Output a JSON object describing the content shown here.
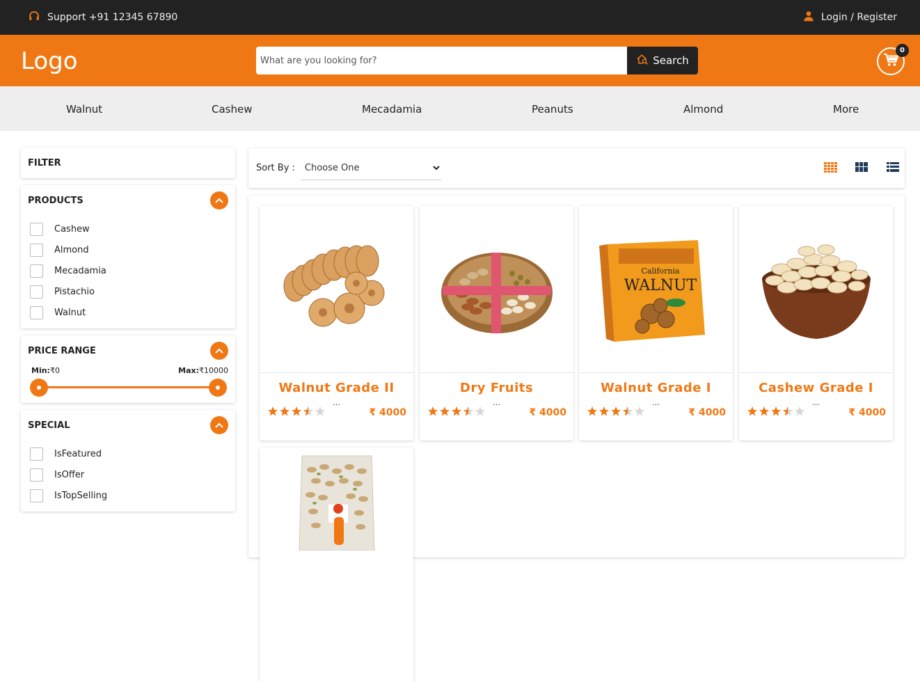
{
  "topbar": {
    "support": "Support +91 12345 67890",
    "login": "Login / Register"
  },
  "header": {
    "logo": "Logo",
    "search_placeholder": "What are you looking for?",
    "search_button": "Search",
    "cart_count": "0"
  },
  "nav": [
    "Walnut",
    "Cashew",
    "Mecadamia",
    "Peanuts",
    "Almond",
    "More"
  ],
  "filter": {
    "title": "FILTER",
    "products": {
      "title": "PRODUCTS",
      "items": [
        "Cashew",
        "Almond",
        "Mecadamia",
        "Pistachio",
        "Walnut"
      ]
    },
    "price_range": {
      "title": "PRICE RANGE",
      "min_label": "Min:",
      "min_value": "₹0",
      "max_label": "Max:",
      "max_value": "₹10000"
    },
    "special": {
      "title": "SPECIAL",
      "items": [
        "IsFeatured",
        "IsOffer",
        "IsTopSelling"
      ]
    }
  },
  "sort": {
    "label": "Sort By :",
    "selected": "Choose One"
  },
  "products": [
    {
      "name": "Walnut Grade II",
      "desc": "...",
      "rating": 3.5,
      "price": "₹ 4000"
    },
    {
      "name": "Dry Fruits",
      "desc": "...",
      "rating": 3.5,
      "price": "₹ 4000"
    },
    {
      "name": "Walnut Grade I",
      "desc": "...",
      "rating": 3.5,
      "price": "₹ 4000"
    },
    {
      "name": "Cashew Grade I",
      "desc": "...",
      "rating": 3.5,
      "price": "₹ 4000"
    }
  ],
  "product_image_text": {
    "walnut_box_line1": "California",
    "walnut_box_line2": "WALNUT"
  },
  "colors": {
    "accent": "#f07814",
    "dark": "#222222",
    "nav_bg": "#eeeeee",
    "icon_blue": "#1e3a5a"
  }
}
